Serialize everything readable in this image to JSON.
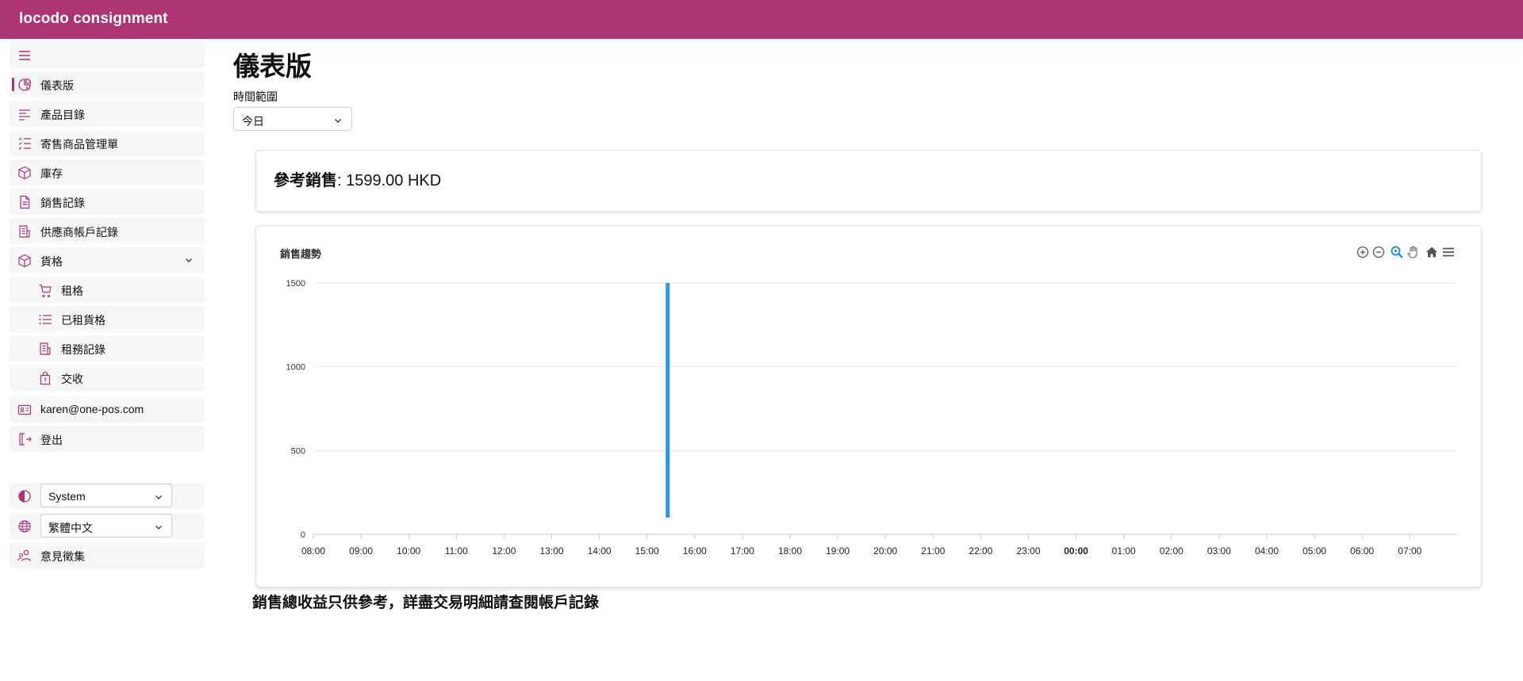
{
  "app": {
    "brand": "locodo consignment"
  },
  "sidebar": {
    "items": [
      {
        "label": "儀表版",
        "icon": "dashboard-icon",
        "active": true
      },
      {
        "label": "產品目錄",
        "icon": "list-align-icon"
      },
      {
        "label": "寄售商品管理單",
        "icon": "checklist-icon"
      },
      {
        "label": "庫存",
        "icon": "box-icon"
      },
      {
        "label": "銷售記錄",
        "icon": "document-icon"
      },
      {
        "label": "供應商帳戶記錄",
        "icon": "receipt-icon"
      },
      {
        "label": "貨格",
        "icon": "box-icon",
        "expanded": true
      },
      {
        "label": "租格",
        "icon": "cart-icon"
      },
      {
        "label": "已租貨格",
        "icon": "bullet-list-icon"
      },
      {
        "label": "租務記錄",
        "icon": "receipt-icon"
      },
      {
        "label": "交收",
        "icon": "shopping-bag-icon"
      },
      {
        "label": "karen@one-pos.com",
        "icon": "id-card-icon"
      },
      {
        "label": "登出",
        "icon": "logout-icon"
      }
    ],
    "theme_select": {
      "value": "System",
      "icon": "theme-contrast-icon"
    },
    "language_select": {
      "value": "繁體中文",
      "icon": "globe-icon"
    },
    "feedback": {
      "label": "意見徵集",
      "icon": "users-icon"
    }
  },
  "main": {
    "title": "儀表版",
    "range_label": "時間範圍",
    "range_value": "今日",
    "sales_label": "參考銷售",
    "sales_value": ": 1599.00 HKD",
    "chart_title": "銷售趨勢",
    "toolbar": [
      "zoom-in-icon",
      "zoom-out-icon",
      "zoom-select-icon",
      "pan-hand-icon",
      "home-reset-icon",
      "menu-icon"
    ],
    "footnote": "銷售總收益只供參考，詳盡交易明細請查閱帳戶記錄"
  },
  "colors": {
    "brand": "#ad3470",
    "bar": "#2196f3"
  },
  "chart_data": {
    "type": "bar",
    "title": "銷售趨勢",
    "xlabel": "",
    "ylabel": "",
    "categories": [
      "08:00",
      "09:00",
      "10:00",
      "11:00",
      "12:00",
      "13:00",
      "14:00",
      "15:00",
      "16:00",
      "17:00",
      "18:00",
      "19:00",
      "20:00",
      "21:00",
      "22:00",
      "23:00",
      "00:00",
      "01:00",
      "02:00",
      "03:00",
      "04:00",
      "05:00",
      "06:00",
      "07:00"
    ],
    "bold_tick": "00:00",
    "y_ticks": [
      0,
      500,
      1000,
      1500
    ],
    "ylim": [
      0,
      1500
    ],
    "series": [
      {
        "points": [
          {
            "x": "15:26",
            "y_from": 100,
            "y_to": 1500
          }
        ]
      }
    ],
    "grid": true
  }
}
